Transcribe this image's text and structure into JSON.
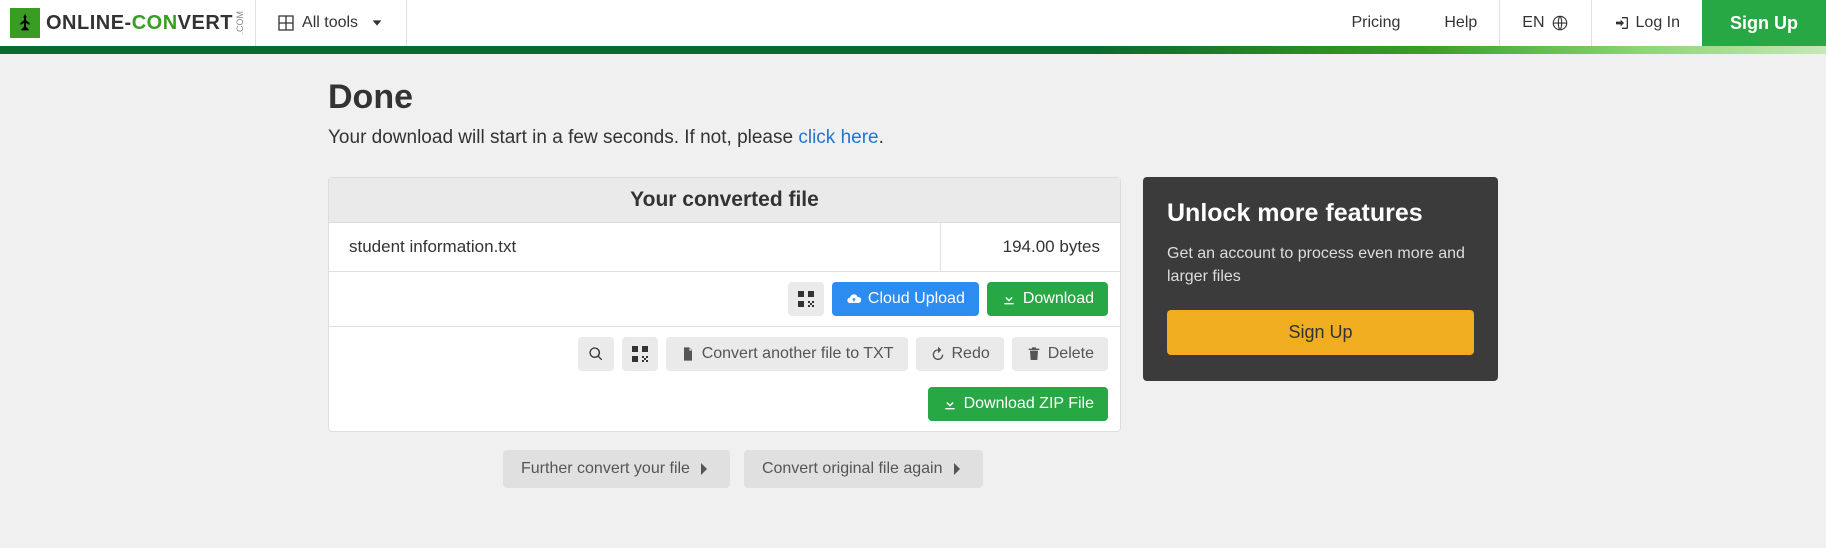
{
  "header": {
    "logo": {
      "part1": "ONLINE-",
      "part2": "CO",
      "part3": "N",
      "part4": "VERT",
      "suffix": ".COM"
    },
    "allTools": "All tools",
    "pricing": "Pricing",
    "help": "Help",
    "lang": "EN",
    "login": "Log In",
    "signup": "Sign Up"
  },
  "main": {
    "title": "Done",
    "subtitle_before": "Your download will start in a few seconds. If not, please ",
    "subtitle_link": "click here",
    "subtitle_after": "."
  },
  "panel": {
    "heading": "Your converted file",
    "file": {
      "name": "student information.txt",
      "size": "194.00 bytes"
    },
    "actions": {
      "cloudUpload": "Cloud Upload",
      "download": "Download",
      "convertAnother": "Convert another file to TXT",
      "redo": "Redo",
      "delete": "Delete",
      "downloadZip": "Download ZIP File"
    }
  },
  "sidebar": {
    "title": "Unlock more features",
    "text": "Get an account to process even more and larger files",
    "cta": "Sign Up"
  },
  "bottom": {
    "furtherConvert": "Further convert your file",
    "convertOriginal": "Convert original file again"
  }
}
